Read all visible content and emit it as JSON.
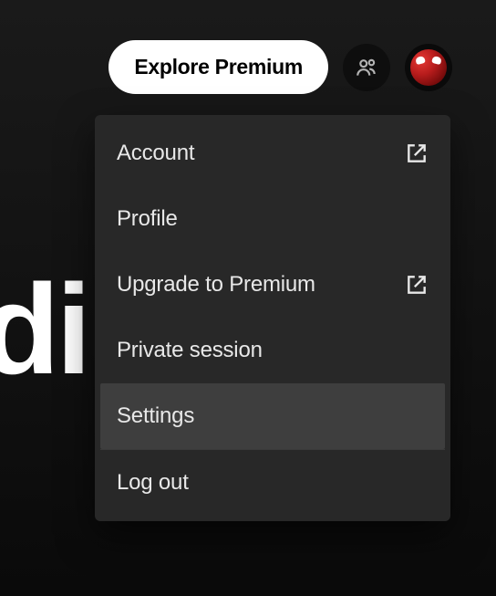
{
  "header": {
    "premium_button_label": "Explore Premium"
  },
  "bg_text": "di",
  "menu": {
    "items": [
      {
        "label": "Account",
        "external": true,
        "highlighted": false
      },
      {
        "label": "Profile",
        "external": false,
        "highlighted": false
      },
      {
        "label": "Upgrade to Premium",
        "external": true,
        "highlighted": false
      },
      {
        "label": "Private session",
        "external": false,
        "highlighted": false
      },
      {
        "label": "Settings",
        "external": false,
        "highlighted": true
      },
      {
        "label": "Log out",
        "external": false,
        "highlighted": false
      }
    ]
  }
}
